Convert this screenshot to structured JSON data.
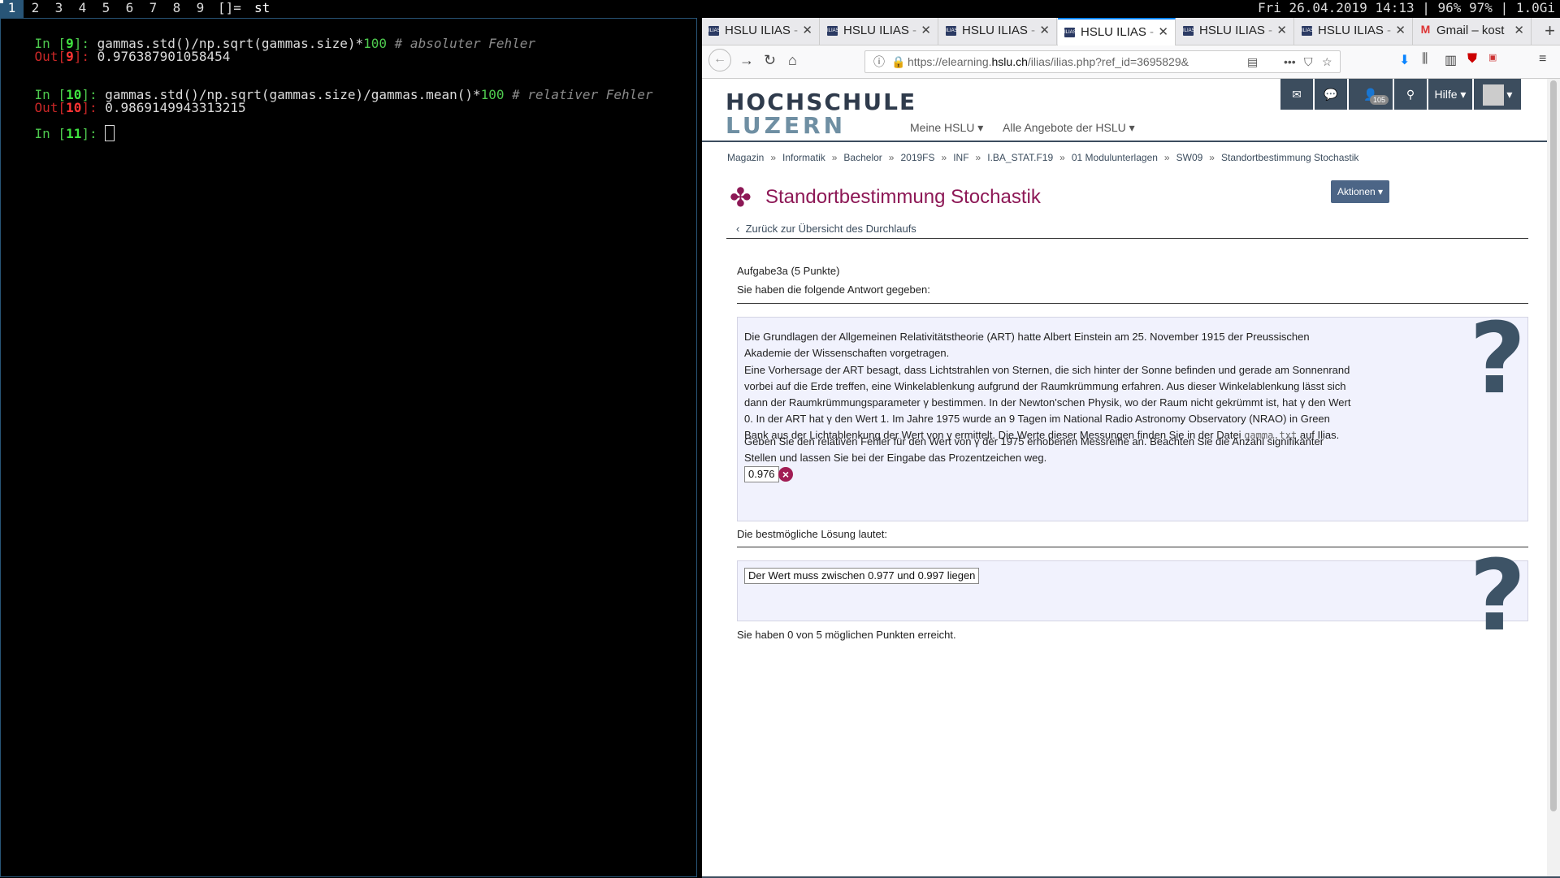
{
  "topbar": {
    "workspaces": [
      "1",
      "2",
      "3",
      "4",
      "5",
      "6",
      "7",
      "8",
      "9"
    ],
    "mode": "[]=",
    "window_title": "st",
    "status": "Fri 26.04.2019 14:13 | 96% 97% | 1.0Gi"
  },
  "terminal": {
    "lines": [
      {
        "prompt_kw": "In [",
        "num": "9",
        "close": "]: ",
        "code": "gammas.std()/np.sqrt(gammas.size)*",
        "num_lit": "100",
        "comment": " # absoluter Fehler"
      },
      {
        "prompt_kw": "Out[",
        "num": "9",
        "close": "]: ",
        "value": "0.976387901058454"
      },
      {
        "prompt_kw": "In [",
        "num": "10",
        "close": "]: ",
        "code": "gammas.std()/np.sqrt(gammas.size)/gammas.mean()*",
        "num_lit": "100",
        "comment": " # relativer Fehler"
      },
      {
        "prompt_kw": "Out[",
        "num": "10",
        "close": "]: ",
        "value": "0.9869149943313215"
      },
      {
        "prompt_kw": "In [",
        "num": "11",
        "close": "]: "
      }
    ]
  },
  "browser": {
    "tabs": [
      {
        "label": "HSLU ILIAS",
        "suffix": "-",
        "favicon": "ILIAS"
      },
      {
        "label": "HSLU ILIAS",
        "suffix": "-",
        "favicon": "ILIAS"
      },
      {
        "label": "HSLU ILIAS",
        "suffix": "-",
        "favicon": "ILIAS"
      },
      {
        "label": "HSLU ILIAS",
        "suffix": "-",
        "favicon": "ILIAS",
        "active": true
      },
      {
        "label": "HSLU ILIAS",
        "suffix": "-",
        "favicon": "ILIAS"
      },
      {
        "label": "HSLU ILIAS",
        "suffix": "-",
        "favicon": "ILIAS"
      },
      {
        "label": "Gmail – kost",
        "suffix": "",
        "favicon": "M"
      }
    ],
    "url_prefix": "https://elearning.",
    "url_domain": "hslu.ch",
    "url_rest": "/ilias/ilias.php?ref_id=3695829&"
  },
  "site": {
    "logo_line1": "HOCHSCHULE",
    "logo_line2": "LUZERN",
    "nav": [
      "Meine HSLU",
      "Alle Angebote der HSLU"
    ],
    "header_buttons": {
      "help": "Hilfe",
      "badge": "105"
    },
    "breadcrumbs": [
      "Magazin",
      "Informatik",
      "Bachelor",
      "2019FS",
      "INF",
      "I.BA_STAT.F19",
      "01 Modulunterlagen",
      "SW09",
      "Standortbestimmung Stochastik"
    ],
    "title": "Standortbestimmung Stochastik",
    "actions_label": "Aktionen",
    "back_link": "Zurück zur Übersicht des Durchlaufs"
  },
  "question": {
    "heading": "Aufgabe3a (5 Punkte)",
    "given_label": "Sie haben die folgende Antwort gegeben:",
    "para1": "Die Grundlagen der Allgemeinen Relativitätstheorie (ART) hatte Albert Einstein am 25. November 1915 der Preussischen Akademie der Wissenschaften vorgetragen.",
    "para2a": "Eine Vorhersage der ART besagt, dass Lichtstrahlen von Sternen, die sich hinter der Sonne befinden und gerade am Sonnenrand vorbei auf die Erde treffen, eine Winkelablenkung aufgrund der Raumkrümmung erfahren. Aus dieser Winkelablenkung lässt sich dann der Raumkrümmungsparameter γ bestimmen. In der Newton'schen Physik, wo der Raum nicht gekrümmt ist, hat γ den Wert 0. In der ART hat γ den Wert 1. Im Jahre 1975 wurde an 9 Tagen im National Radio Astronomy Observatory (NRAO) in Green Bank aus der Lichtablenkung der Wert von γ ermittelt. Die Werte dieser Messungen finden Sie in der Datei",
    "file": "gamma.txt",
    "para2b": "auf Ilias.",
    "para3": "Geben Sie den relativen Fehler für den Wert von γ der 1975 erhobenen Messreihe an. Beachten Sie die Anzahl signifikanter Stellen und lassen Sie bei der Eingabe das Prozentzeichen weg.",
    "answer_value": "0.976",
    "best_label": "Die bestmögliche Lösung lautet:",
    "solution": "Der Wert muss zwischen 0.977 und 0.997 liegen",
    "score": "Sie haben 0 von 5 möglichen Punkten erreicht."
  }
}
